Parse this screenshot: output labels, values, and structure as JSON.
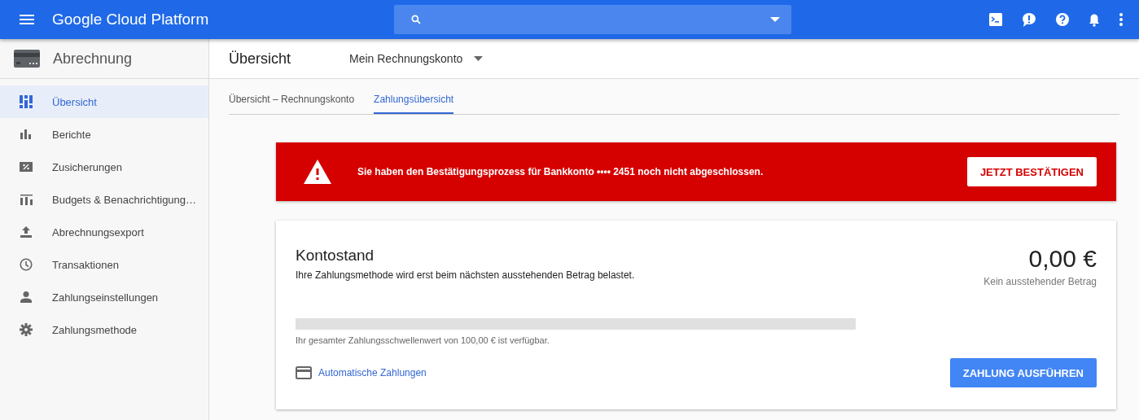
{
  "topbar": {
    "title": "Google Cloud Platform"
  },
  "sidebar": {
    "title": "Abrechnung",
    "items": [
      {
        "label": "Übersicht",
        "kind": "dashboard",
        "selected": true
      },
      {
        "label": "Berichte",
        "kind": "bars",
        "selected": false
      },
      {
        "label": "Zusicherungen",
        "kind": "percent",
        "selected": false
      },
      {
        "label": "Budgets & Benachrichtigung…",
        "kind": "budget",
        "selected": false
      },
      {
        "label": "Abrechnungsexport",
        "kind": "upload",
        "selected": false
      },
      {
        "label": "Transaktionen",
        "kind": "clock",
        "selected": false
      },
      {
        "label": "Zahlungseinstellungen",
        "kind": "person",
        "selected": false
      },
      {
        "label": "Zahlungsmethode",
        "kind": "gear",
        "selected": false
      }
    ]
  },
  "header": {
    "title": "Übersicht",
    "account": "Mein Rechnungskonto"
  },
  "tabs": [
    {
      "label": "Übersicht – Rechnungskonto",
      "selected": false
    },
    {
      "label": "Zahlungsübersicht",
      "selected": true
    }
  ],
  "alert": {
    "message": "Sie haben den Bestätigungsprozess für Bankkonto •••• 2451 noch nicht abgeschlossen.",
    "button": "JETZT BESTÄTIGEN"
  },
  "balance": {
    "title": "Kontostand",
    "subtitle": "Ihre Zahlungsmethode wird erst beim nächsten ausstehenden Betrag belastet.",
    "amount": "0,00 €",
    "amount_caption": "Kein ausstehender Betrag",
    "level": 0,
    "threshold_text": "Ihr gesamter Zahlungsschwellenwert von 100,00 € ist verfügbar.",
    "link": "Automatische Zahlungen",
    "button": "ZAHLUNG AUSFÜHREN"
  }
}
